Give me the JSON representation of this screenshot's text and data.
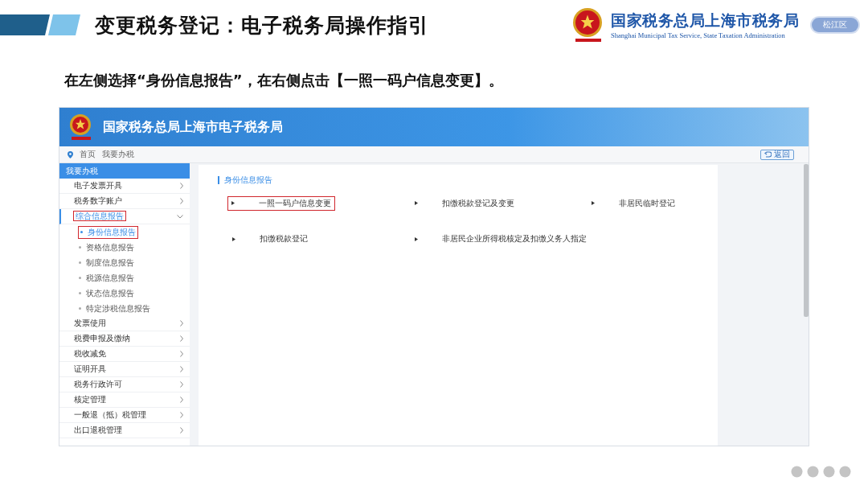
{
  "slide": {
    "title": "变更税务登记：电子税务局操作指引",
    "org_name": "国家税务总局上海市税务局",
    "org_name_en": "Shanghai Municipal Tax Service, State Taxation Administration",
    "district": "松江区",
    "instruction": "在左侧选择“身份信息报告”，在右侧点击【一照一码户信息变更】。"
  },
  "app": {
    "site_title": "国家税务总局上海市电子税务局",
    "breadcrumb": [
      "首页",
      "我要办税"
    ],
    "back_button": "返回",
    "menu_header": "我要办税",
    "menu": [
      {
        "label": "电子发票开具",
        "expanded": false,
        "highlighted": false
      },
      {
        "label": "税务数字账户",
        "expanded": false,
        "highlighted": false
      },
      {
        "label": "综合信息报告",
        "expanded": true,
        "highlighted": true,
        "children": [
          {
            "label": "身份信息报告",
            "selected": true,
            "highlighted": true
          },
          {
            "label": "资格信息报告",
            "selected": false,
            "highlighted": false
          },
          {
            "label": "制度信息报告",
            "selected": false,
            "highlighted": false
          },
          {
            "label": "税源信息报告",
            "selected": false,
            "highlighted": false
          },
          {
            "label": "状态信息报告",
            "selected": false,
            "highlighted": false
          },
          {
            "label": "特定涉税信息报告",
            "selected": false,
            "highlighted": false
          }
        ]
      },
      {
        "label": "发票使用",
        "expanded": false,
        "highlighted": false
      },
      {
        "label": "税费申报及缴纳",
        "expanded": false,
        "highlighted": false
      },
      {
        "label": "税收减免",
        "expanded": false,
        "highlighted": false
      },
      {
        "label": "证明开具",
        "expanded": false,
        "highlighted": false
      },
      {
        "label": "税务行政许可",
        "expanded": false,
        "highlighted": false
      },
      {
        "label": "核定管理",
        "expanded": false,
        "highlighted": false
      },
      {
        "label": "一般退（抵）税管理",
        "expanded": false,
        "highlighted": false
      },
      {
        "label": "出口退税管理",
        "expanded": false,
        "highlighted": false
      }
    ],
    "section_title": "身份信息报告",
    "links": [
      {
        "label": "一照一码户信息变更",
        "highlighted": true
      },
      {
        "label": "扣缴税款登记及变更",
        "highlighted": false
      },
      {
        "label": "非居民临时登记",
        "highlighted": false
      },
      {
        "label": "扣缴税款登记",
        "highlighted": false
      },
      {
        "label": "非居民企业所得税核定及扣缴义务人指定",
        "highlighted": false
      }
    ]
  }
}
